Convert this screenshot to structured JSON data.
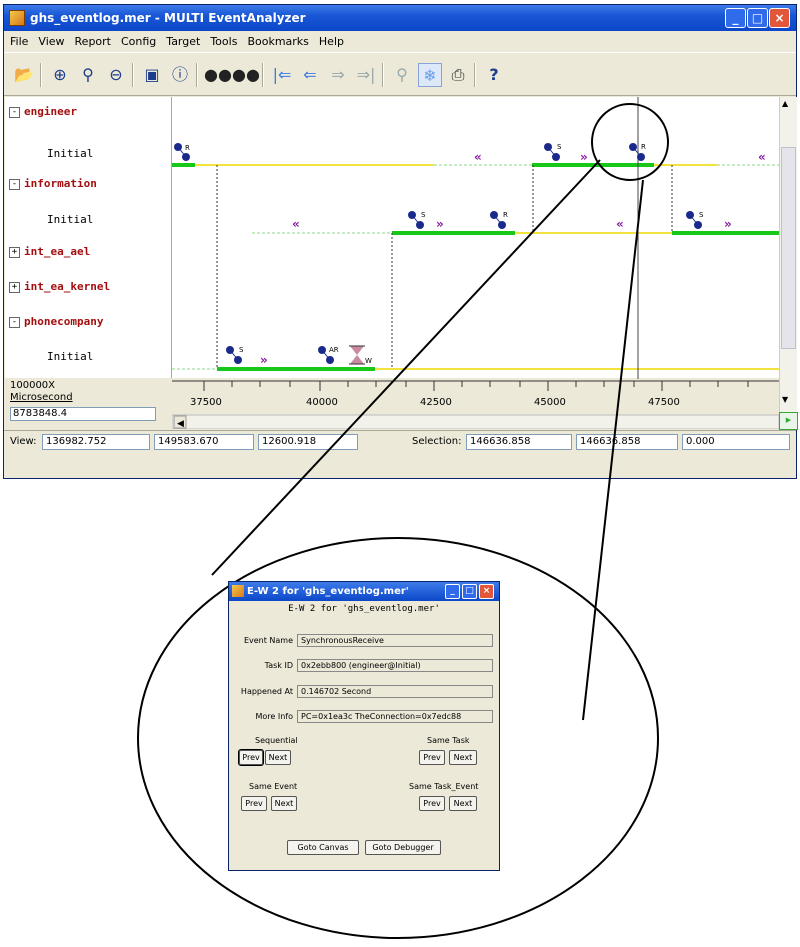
{
  "window": {
    "title": "ghs_eventlog.mer - MULTI EventAnalyzer",
    "controls": [
      "_",
      "□",
      "×"
    ]
  },
  "menu": [
    "File",
    "View",
    "Report",
    "Config",
    "Target",
    "Tools",
    "Bookmarks",
    "Help"
  ],
  "toolbar_icons": [
    "open-icon",
    "zoom-in-icon",
    "zoom-location-icon",
    "zoom-out-icon",
    "canvas-icon",
    "info-icon",
    "find-icon",
    "find-next-icon",
    "first-event-icon",
    "prev-event-icon",
    "next-event-icon",
    "last-event-icon",
    "zoom-select-icon",
    "selection-icon",
    "print-icon",
    "help-icon"
  ],
  "toolbar": {
    "help_label": "?"
  },
  "tree": [
    {
      "name": "engineer",
      "expanded": true,
      "child": "Initial"
    },
    {
      "name": "information",
      "expanded": true,
      "child": "Initial"
    },
    {
      "name": "int_ea_ael",
      "expanded": false
    },
    {
      "name": "int_ea_kernel",
      "expanded": false
    },
    {
      "name": "phonecompany",
      "expanded": true,
      "child": "Initial"
    }
  ],
  "units": {
    "scale": "100000X",
    "unit": "Microsecond",
    "value": "8783848.4"
  },
  "axis_ticks": [
    "37500",
    "40000",
    "42500",
    "45000",
    "47500"
  ],
  "event_labels": {
    "send": "S",
    "receive": "R",
    "reply": "AR",
    "wait": "W"
  },
  "status": {
    "view_label": "View:",
    "view_start": "136982.752",
    "view_end": "149583.670",
    "view_span": "12600.918",
    "selection_label": "Selection:",
    "sel_start": "146636.858",
    "sel_end": "146636.858",
    "sel_span": "0.000"
  },
  "dialog": {
    "title": "E-W 2 for 'ghs_eventlog.mer'",
    "heading": "E-W 2  for  'ghs_eventlog.mer'",
    "fields": [
      {
        "label": "Event Name",
        "value": "SynchronousReceive"
      },
      {
        "label": "Task ID",
        "value": "0x2ebb800 (engineer@Initial)"
      },
      {
        "label": "Happened At",
        "value": "0.146702 Second"
      },
      {
        "label": "More Info",
        "value": "PC=0x1ea3c TheConnection=0x7edc88"
      }
    ],
    "groups": {
      "sequential": "Sequential",
      "same_task": "Same Task",
      "same_event": "Same Event",
      "same_task_event": "Same Task_Event"
    },
    "prev": "Prev",
    "next": "Next",
    "goto_canvas": "Goto Canvas",
    "goto_debugger": "Goto Debugger"
  }
}
